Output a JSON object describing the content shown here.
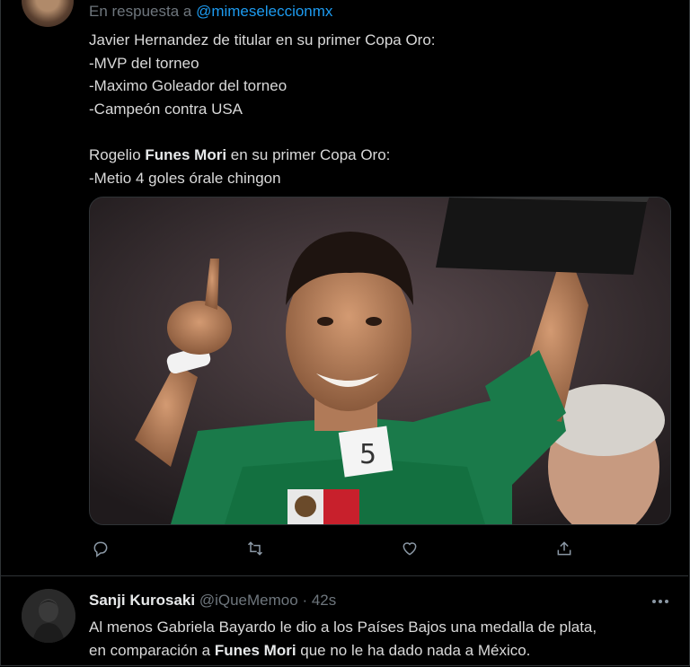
{
  "tweet": {
    "reply_prefix": "En respuesta a ",
    "reply_handle": "@mimeseleccionmx",
    "lines": [
      "Javier Hernandez de titular en su primer Copa Oro:",
      "-MVP del torneo",
      "-Maximo Goleador del torneo",
      "-Campeón contra USA"
    ],
    "line5_pre": "Rogelio ",
    "line5_bold": "Funes Mori",
    "line5_post": " en su primer Copa Oro:",
    "line6": "-Metio 4 goles órale chingon",
    "media": {
      "jersey_number": "5"
    }
  },
  "actions": [
    "reply-icon",
    "retweet-icon",
    "like-icon",
    "share-icon"
  ],
  "reply": {
    "name": "Sanji Kurosaki",
    "handle": "@iQueMemoo",
    "separator": "·",
    "time": "42s",
    "line1": "Al menos Gabriela Bayardo le dio a los Países Bajos una medalla de plata,",
    "line2_pre": "en comparación a ",
    "line2_bold": "Funes Mori",
    "line2_post": " que no le ha dado nada a México."
  },
  "colors": {
    "background": "#000000",
    "accent": "#1d9bf0",
    "muted": "#6e767d",
    "text": "#d9d9d9",
    "divider": "#2f3336"
  }
}
